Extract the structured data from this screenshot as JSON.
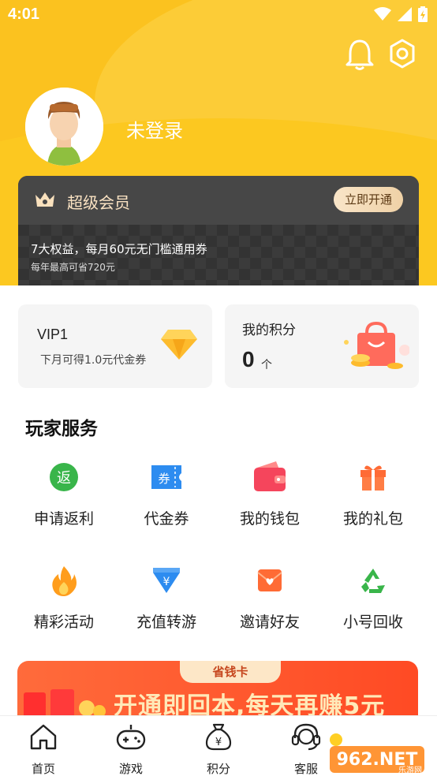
{
  "status_bar": {
    "time": "4:01"
  },
  "profile": {
    "login_text": "未登录"
  },
  "vip_card": {
    "title": "超级会员",
    "button": "立即开通",
    "desc_main": "7大权益，每月60元无门槛通用券",
    "desc_sub": "每年最高可省720元"
  },
  "level_card": {
    "level": "VIP1",
    "desc": "下月可得1.0元代金券"
  },
  "points_card": {
    "title": "我的积分",
    "value": "0",
    "unit": "个"
  },
  "services": {
    "title": "玩家服务",
    "items": [
      {
        "label": "申请返利",
        "icon": "rebate-icon",
        "glyph": "返"
      },
      {
        "label": "代金券",
        "icon": "voucher-icon",
        "glyph": "券"
      },
      {
        "label": "我的钱包",
        "icon": "wallet-icon"
      },
      {
        "label": "我的礼包",
        "icon": "gift-icon"
      },
      {
        "label": "精彩活动",
        "icon": "fire-icon"
      },
      {
        "label": "充值转游",
        "icon": "recharge-icon",
        "glyph": "¥"
      },
      {
        "label": "邀请好友",
        "icon": "invite-icon"
      },
      {
        "label": "小号回收",
        "icon": "recycle-icon"
      }
    ]
  },
  "banner": {
    "tag": "省钱卡",
    "text": "开通即回本,每天再赚5元"
  },
  "tabbar": {
    "items": [
      {
        "label": "首页",
        "icon": "home-icon"
      },
      {
        "label": "游戏",
        "icon": "gamepad-icon"
      },
      {
        "label": "积分",
        "icon": "points-bag-icon",
        "glyph": "¥"
      },
      {
        "label": "客服",
        "icon": "headset-icon"
      }
    ]
  },
  "watermark": {
    "text": "962.NET",
    "sub": "乐游网"
  },
  "colors": {
    "header_yellow": "#fbc21f",
    "vip_dark": "#3a3a3a",
    "banner_red": "#ff4a24"
  }
}
